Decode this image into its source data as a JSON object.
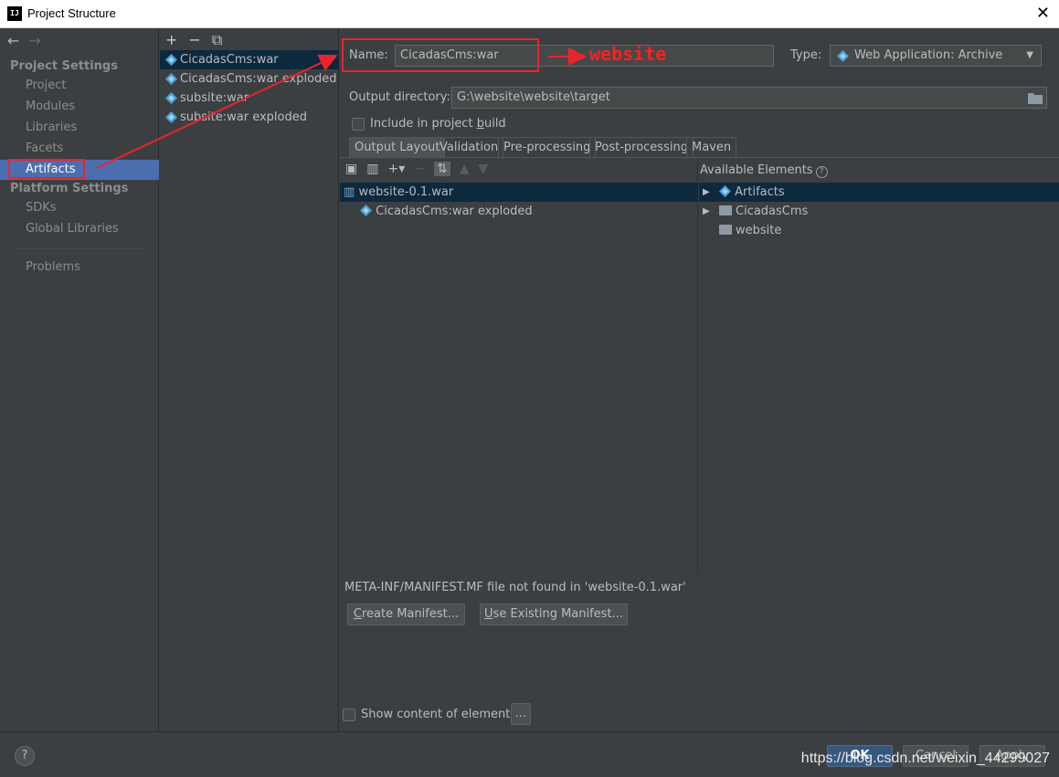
{
  "window": {
    "title": "Project Structure",
    "app_icon_text": "IJ",
    "close_glyph": "✕"
  },
  "sidebar": {
    "back_glyph": "←",
    "forward_glyph": "→",
    "project_settings_header": "Project Settings",
    "project_items": [
      "Project",
      "Modules",
      "Libraries",
      "Facets",
      "Artifacts"
    ],
    "platform_settings_header": "Platform Settings",
    "platform_items": [
      "SDKs",
      "Global Libraries"
    ],
    "problems": "Problems",
    "selected": "Artifacts",
    "selection_color": "#4b6eaf"
  },
  "artifacts_list": {
    "toolbar": [
      "+",
      "−",
      "⧉"
    ],
    "items": [
      "CicadasCms:war",
      "CicadasCms:war exploded",
      "subsite:war",
      "subsite:war exploded"
    ],
    "selected": "CicadasCms:war"
  },
  "detail": {
    "name_label": "Name:",
    "name_value": "CicadasCms:war",
    "type_label": "Type:",
    "type_value": "Web Application: Archive",
    "output_dir_label": "Output directory:",
    "output_dir_value": "G:\\website\\website\\target",
    "include_build_label": "Include in project build",
    "include_build_checked": false,
    "tabs": [
      "Output Layout",
      "Validation",
      "Pre-processing",
      "Post-processing",
      "Maven"
    ],
    "active_tab": "Output Layout",
    "layout_tree": [
      {
        "label": "website-0.1.war",
        "level": 0,
        "selected": true
      },
      {
        "label": "CicadasCms:war exploded",
        "level": 1,
        "selected": false
      }
    ],
    "available_elements_title": "Available Elements",
    "available_elements": [
      {
        "label": "Artifacts",
        "expandable": true,
        "icon": "artifacts-icon"
      },
      {
        "label": "CicadasCms",
        "expandable": true,
        "icon": "module-folder-icon"
      },
      {
        "label": "website",
        "expandable": false,
        "icon": "module-folder-icon"
      }
    ],
    "manifest_message": "META-INF/MANIFEST.MF file not found in 'website-0.1.war'",
    "create_manifest_btn": "Create Manifest...",
    "use_existing_manifest_btn": "Use Existing Manifest...",
    "show_content_label": "Show content of elements",
    "show_content_checked": false,
    "ellipsis_btn": "..."
  },
  "bottom": {
    "help": "?",
    "ok": "OK",
    "cancel": "Cancel",
    "apply": "Apply",
    "watermark": "https://blog.csdn.net/weixin_44299027"
  },
  "annotation": {
    "text": "website",
    "color": "#e8252f"
  }
}
